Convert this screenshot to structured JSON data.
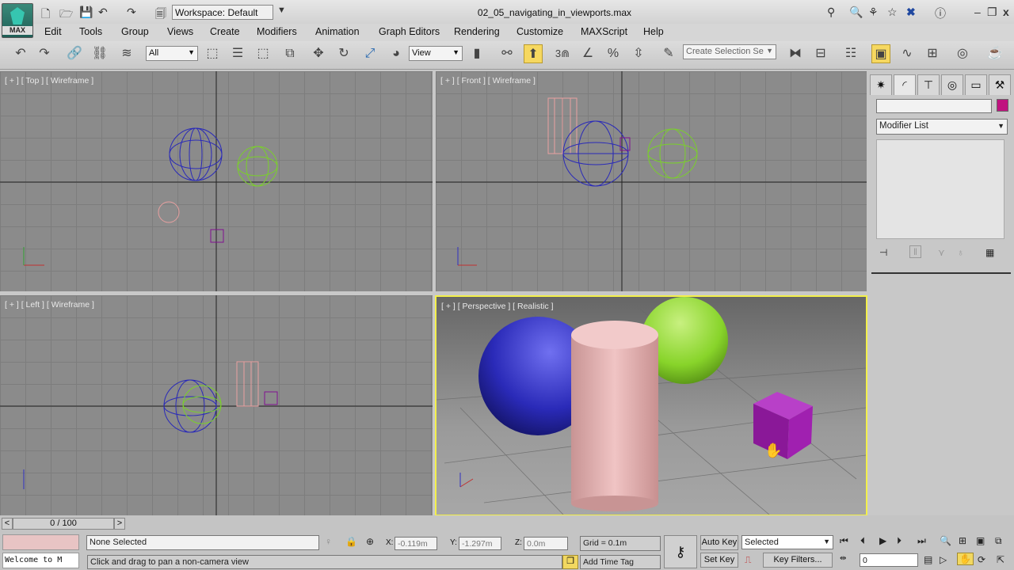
{
  "app": {
    "logo_label": "MAX",
    "title": "02_05_navigating_in_viewports.max",
    "workspace": "Workspace: Default"
  },
  "menu": [
    "Edit",
    "Tools",
    "Group",
    "Views",
    "Create",
    "Modifiers",
    "Animation",
    "Graph Editors",
    "Rendering",
    "Customize",
    "MAXScript",
    "Help"
  ],
  "toolbar": {
    "selection_filter": "All",
    "ref_coord": "View",
    "named_selection": "Create Selection Se",
    "snap_angle": "3"
  },
  "viewports": {
    "top": "[ + ] [ Top ] [ Wireframe ]",
    "front": "[ + ] [ Front ] [ Wireframe ]",
    "left": "[ + ] [ Left ] [ Wireframe ]",
    "perspective": "[ + ] [ Perspective ] [ Realistic ]"
  },
  "command_panel": {
    "modifier_list": "Modifier List",
    "object_color": "#c0137f"
  },
  "timeline": {
    "frame": "0 / 100"
  },
  "status": {
    "maxscript": "Welcome to M",
    "selection": "None Selected",
    "prompt": "Click and drag to pan a non-camera view",
    "x": "-0.119m",
    "y": "-1.297m",
    "z": "0.0m",
    "x_label": "X:",
    "y_label": "Y:",
    "z_label": "Z:",
    "grid": "Grid = 0.1m",
    "add_time_tag": "Add Time Tag",
    "auto_key": "Auto Key",
    "set_key": "Set Key",
    "key_mode": "Selected",
    "key_filters": "Key Filters...",
    "current_frame": "0"
  },
  "colors": {
    "active_viewport": "#f3f04a",
    "sphere_blue": "#2a2ab8",
    "sphere_green": "#88d42a",
    "cylinder": "#e8b4b4",
    "box": "#a020b0"
  }
}
